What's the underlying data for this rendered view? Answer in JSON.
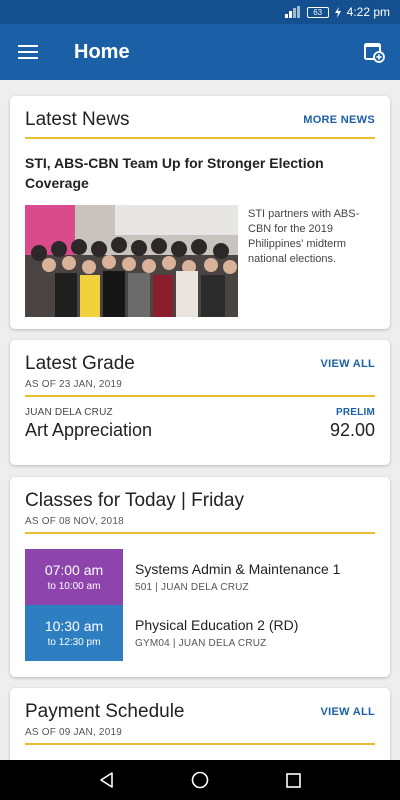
{
  "status_bar": {
    "signal": "signal-icon",
    "battery_level": "63",
    "charging": "charging-icon",
    "time": "4:22 pm"
  },
  "app_bar": {
    "title": "Home",
    "menu_icon": "menu-icon",
    "action_icon": "new-window-icon",
    "color": "#1b5fa6"
  },
  "news": {
    "title": "Latest News",
    "link": "MORE NEWS",
    "headline": "STI, ABS-CBN Team Up for Stronger Election Coverage",
    "summary": "STI partners with ABS-CBN for the 2019 Philippines' midterm national elections."
  },
  "grade": {
    "title": "Latest Grade",
    "link": "VIEW ALL",
    "as_of": "AS OF 23 JAN, 2019",
    "student": "JUAN DELA CRUZ",
    "term": "PRELIM",
    "subject": "Art Appreciation",
    "value": "92.00"
  },
  "classes": {
    "title": "Classes for Today | Friday",
    "as_of": "AS OF 08 NOV, 2018",
    "items": [
      {
        "start": "07:00 am",
        "end": "to 10:00 am",
        "name": "Systems Admin & Maintenance 1",
        "meta": "501 | JUAN DELA CRUZ",
        "color": "#8e44ad"
      },
      {
        "start": "10:30 am",
        "end": "to 12:30 pm",
        "name": "Physical Education 2 (RD)",
        "meta": "GYM04 | JUAN DELA CRUZ",
        "color": "#2e7ec2"
      }
    ]
  },
  "payment": {
    "title": "Payment Schedule",
    "link": "VIEW ALL",
    "as_of": "AS OF 09 JAN, 2019"
  },
  "nav_bar": {
    "back": "back-icon",
    "home": "home-icon",
    "recents": "recents-icon"
  },
  "colors": {
    "accent_gold": "#e9be34",
    "status_bar": "#14508f"
  }
}
